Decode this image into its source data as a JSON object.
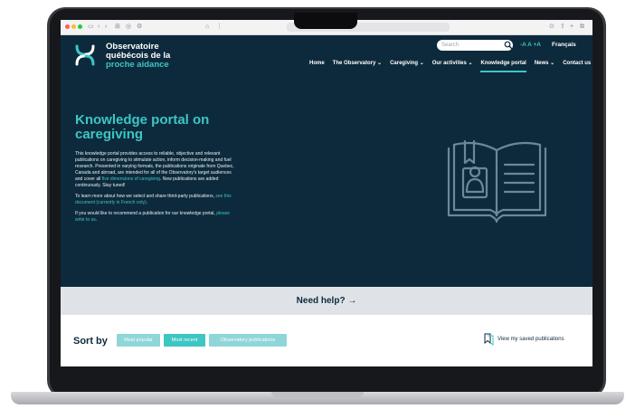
{
  "browser": {
    "url": ""
  },
  "header": {
    "logo_line1": "Observatoire",
    "logo_line2": "québécois de la",
    "logo_line3": "proche aidance",
    "search_placeholder": "Search",
    "font_size_control": "-A A +A",
    "language": "Français"
  },
  "nav": {
    "items": [
      "Home",
      "The Observatory ⌄",
      "Caregiving ⌄",
      "Our activities ⌄",
      "Knowledge portal",
      "News ⌄",
      "Contact us"
    ],
    "active_index": 4
  },
  "hero": {
    "title": "Knowledge portal on caregiving",
    "p1_text": "This knowledge portal provides access to reliable, objective and relevant publications on caregiving to stimulate action, inform decision-making and fuel research. Presented in varying formats, the publications originate from Quebec, Canada and abroad, are intended for all of the Observatory's target audiences and cover all ",
    "p1_link": "five dimensions of caregiving",
    "p1_tail": ". New publications are added continuously. Stay tuned!",
    "p2_text": "To learn more about how we select and share third-party publications, ",
    "p2_link": "see this document (currently in French only)",
    "p2_tail": ".",
    "p3_text": "If you would like to recommend a publication for our knowledge portal, ",
    "p3_link": "please write to us",
    "p3_tail": "."
  },
  "help": {
    "label": "Need help? →"
  },
  "sort": {
    "label": "Sort by",
    "buttons": [
      "Most popular",
      "Most recent",
      "Observatory publications"
    ],
    "saved": "View my saved publications"
  },
  "colors": {
    "navy": "#0d2a3c",
    "teal": "#3dc6c3",
    "light_teal": "#8fd6d8",
    "help_band": "#dfe3e7"
  }
}
